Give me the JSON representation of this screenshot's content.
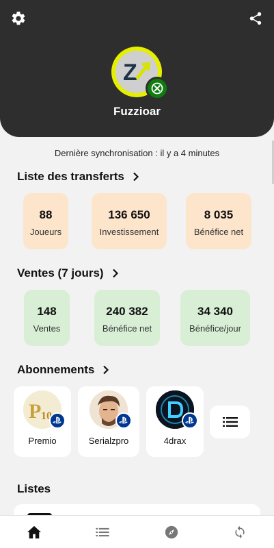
{
  "header": {
    "username": "Fuzzioar",
    "settings_icon": "gear-icon",
    "share_icon": "share-icon",
    "platform": "xbox",
    "avatar_letter": "Z"
  },
  "sync_text": "Dernière synchronisation : il y a 4 minutes",
  "transfers": {
    "title": "Liste des transferts",
    "stats": [
      {
        "value": "88",
        "label": "Joueurs"
      },
      {
        "value": "136 650",
        "label": "Investissement"
      },
      {
        "value": "8 035",
        "label": "Bénéfice net"
      }
    ]
  },
  "sales": {
    "title": "Ventes (7 jours)",
    "stats": [
      {
        "value": "148",
        "label": "Ventes"
      },
      {
        "value": "240 382",
        "label": "Bénéfice net"
      },
      {
        "value": "34 340",
        "label": "Bénéfice/jour"
      }
    ]
  },
  "subscriptions": {
    "title": "Abonnements",
    "items": [
      {
        "name": "Premio",
        "platform": "playstation"
      },
      {
        "name": "Serialzpro",
        "platform": "playstation"
      },
      {
        "name": "4drax",
        "platform": "playstation"
      }
    ]
  },
  "lists": {
    "title": "Listes"
  },
  "colors": {
    "header_bg": "#2e2e2e",
    "orange_card": "#fde5cc",
    "green_card": "#d8efd6",
    "xbox_green": "#107c10",
    "ps_blue": "#003791",
    "avatar_ring": "#e6ef00"
  },
  "nav": [
    {
      "name": "home-icon"
    },
    {
      "name": "list-icon"
    },
    {
      "name": "compass-icon"
    },
    {
      "name": "sync-icon"
    }
  ]
}
